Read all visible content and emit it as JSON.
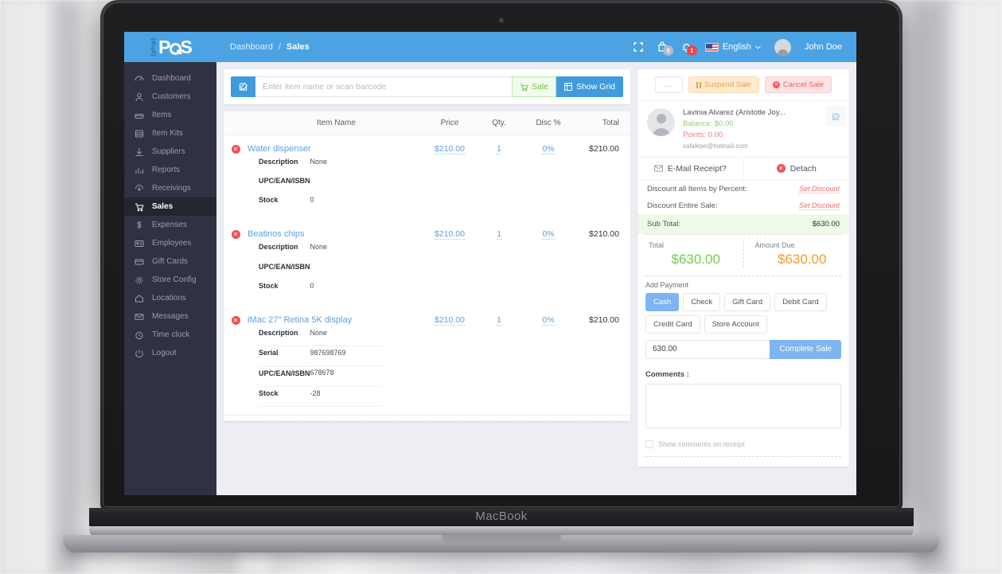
{
  "device": {
    "label": "MacBook"
  },
  "topbar": {
    "logo": {
      "php": "(php)",
      "pos": "POS"
    },
    "breadcrumb": {
      "root": "Dashboard",
      "sep": "/",
      "current": "Sales"
    },
    "icons": {
      "fullscreen": "fullscreen-icon",
      "cart": {
        "name": "cart-icon",
        "badge": "3"
      },
      "bell": {
        "name": "bell-icon",
        "badge": "1"
      }
    },
    "language": {
      "label": "English",
      "flag": "us-flag-icon"
    },
    "user": {
      "name": "John Doe",
      "avatar": "user-avatar"
    }
  },
  "sidebar": {
    "items": [
      {
        "label": "Dashboard",
        "icon": "dashboard-icon",
        "active": false
      },
      {
        "label": "Customers",
        "icon": "customers-icon",
        "active": false
      },
      {
        "label": "Items",
        "icon": "items-icon",
        "active": false
      },
      {
        "label": "Item Kits",
        "icon": "item-kits-icon",
        "active": false
      },
      {
        "label": "Suppliers",
        "icon": "suppliers-icon",
        "active": false
      },
      {
        "label": "Reports",
        "icon": "reports-icon",
        "active": false
      },
      {
        "label": "Receivings",
        "icon": "receivings-icon",
        "active": false
      },
      {
        "label": "Sales",
        "icon": "sales-icon",
        "active": true
      },
      {
        "label": "Expenses",
        "icon": "expenses-icon",
        "active": false
      },
      {
        "label": "Employees",
        "icon": "employees-icon",
        "active": false
      },
      {
        "label": "Gift Cards",
        "icon": "gift-cards-icon",
        "active": false
      },
      {
        "label": "Store Config",
        "icon": "store-config-icon",
        "active": false
      },
      {
        "label": "Locations",
        "icon": "locations-icon",
        "active": false
      },
      {
        "label": "Messages",
        "icon": "messages-icon",
        "active": false
      },
      {
        "label": "Time clock",
        "icon": "time-clock-icon",
        "active": false
      },
      {
        "label": "Logout",
        "icon": "logout-icon",
        "active": false
      }
    ]
  },
  "search": {
    "placeholder": "Enter item name or scan barcode",
    "value": "",
    "edit_icon": "edit-icon",
    "sale_button": "Sale",
    "grid_button": "Show Grid"
  },
  "items_table": {
    "columns": {
      "item_name": "Item Name",
      "price": "Price",
      "qty": "Qty.",
      "disc": "Disc %",
      "total": "Total"
    },
    "rows": [
      {
        "name": "Water dispenser",
        "price": "$210.00",
        "qty": "1",
        "disc": "0%",
        "total": "$210.00",
        "details": [
          {
            "key": "Description",
            "value": "None",
            "dotted": false
          },
          {
            "key": "UPC/EAN/ISBN",
            "value": "",
            "dotted": false
          },
          {
            "key": "Stock",
            "value": "0",
            "dotted": false
          }
        ]
      },
      {
        "name": "Beatinos chips",
        "price": "$210.00",
        "qty": "1",
        "disc": "0%",
        "total": "$210.00",
        "details": [
          {
            "key": "Description",
            "value": "None",
            "dotted": false
          },
          {
            "key": "UPC/EAN/ISBN",
            "value": "",
            "dotted": false
          },
          {
            "key": "Stock",
            "value": "0",
            "dotted": false
          }
        ]
      },
      {
        "name": "iMac 27\" Retina 5K display",
        "price": "$210.00",
        "qty": "1",
        "disc": "0%",
        "total": "$210.00",
        "details": [
          {
            "key": "Description",
            "value": "None",
            "dotted": false
          },
          {
            "key": "Serial",
            "value": "987698769",
            "dotted": true
          },
          {
            "key": "UPC/EAN/ISBN",
            "value": "678678",
            "dotted": false
          },
          {
            "key": "Stock",
            "value": "-28",
            "dotted": false
          }
        ]
      }
    ]
  },
  "cart": {
    "actions": {
      "more": "...",
      "suspend": "Suspend Sale",
      "cancel": "Cancel Sale"
    },
    "customer": {
      "name": "Lavinia Alvarez (Aristotle Joy...",
      "balance": "Balance: $0.00",
      "points": "Points: 0.00",
      "email": "xafalepe@hotmail.com",
      "edit_icon": "edit-customer-icon"
    },
    "email_receipt": "E-Mail Receipt?",
    "detach": "Detach",
    "discount_items_label": "Discount all Items by Percent:",
    "discount_items_action": "Set Discount",
    "discount_sale_label": "Discount Entire Sale:",
    "discount_sale_action": "Set Discount",
    "subtotal_label": "Sub Total:",
    "subtotal_value": "$630.00",
    "total_label": "Total",
    "total_value": "$630.00",
    "amount_due_label": "Amount Due",
    "amount_due_value": "$630.00",
    "add_payment_label": "Add Payment",
    "payment_methods": [
      {
        "label": "Cash",
        "selected": true
      },
      {
        "label": "Check",
        "selected": false
      },
      {
        "label": "Gift Card",
        "selected": false
      },
      {
        "label": "Debit Card",
        "selected": false
      },
      {
        "label": "Credit Card",
        "selected": false
      },
      {
        "label": "Store Account",
        "selected": false
      }
    ],
    "amount_value": "630.00",
    "complete_button": "Complete Sale",
    "comments_label": "Comments :",
    "comments_value": "",
    "show_comments_label": "Show comments on receipt"
  },
  "colors": {
    "brand_blue": "#4ba3e3",
    "sidebar": "#2f3240",
    "green": "#6fce4d",
    "orange": "#f79a2c",
    "red": "#ef5b5f"
  }
}
